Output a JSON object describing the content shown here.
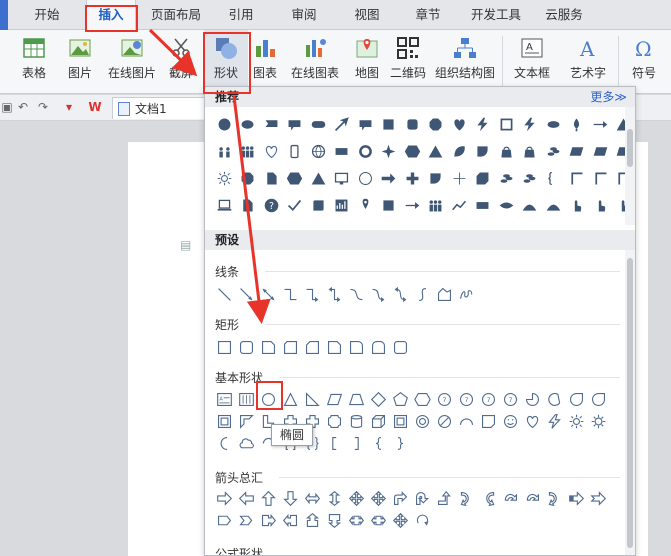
{
  "menu": {
    "tabs": [
      "开始",
      "插入",
      "页面布局",
      "引用",
      "审阅",
      "视图",
      "章节",
      "开发工具",
      "云服务"
    ]
  },
  "ribbon": {
    "buttons": [
      "表格",
      "图片",
      "在线图片",
      "截屏",
      "形状",
      "图表",
      "在线图表",
      "地图",
      "二维码",
      "组织结构图",
      "文本框",
      "艺术字",
      "符号"
    ]
  },
  "document": {
    "tab_title": "文档1",
    "wps_badge": "W"
  },
  "panel": {
    "recommended_title": "推荐",
    "more_label": "更多≫",
    "presets_title": "预设",
    "categories": [
      "线条",
      "矩形",
      "基本形状",
      "箭头总汇",
      "公式形状"
    ]
  },
  "tooltip": {
    "text": "椭圆"
  },
  "colors": {
    "accent_red": "#e8332a",
    "shape_blue": "#4f6b8f",
    "active_tab": "#1f5fbf"
  }
}
